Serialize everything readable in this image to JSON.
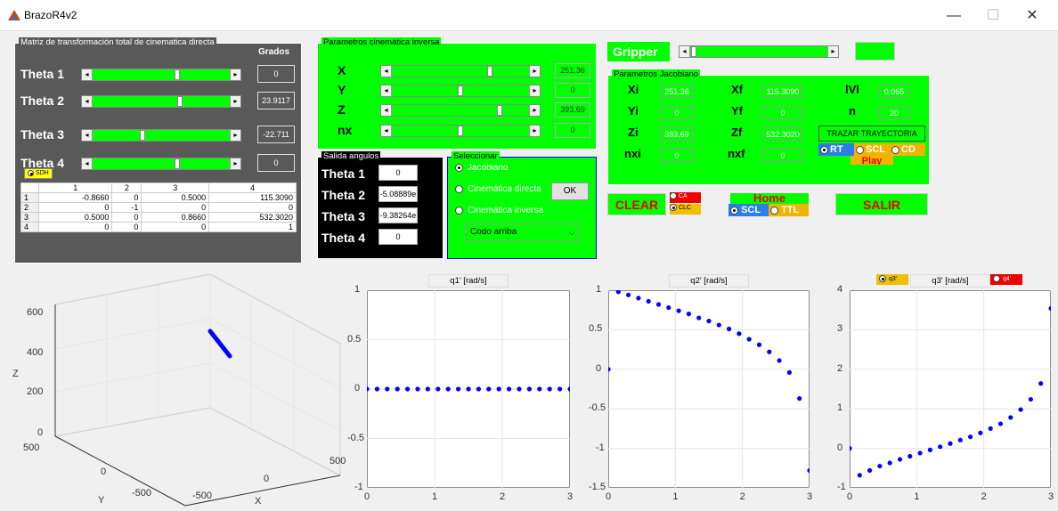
{
  "window": {
    "title": "BrazoR4v2",
    "min": "—",
    "max": "☐",
    "close": "✕",
    "app_icon": "matlab-icon"
  },
  "fk": {
    "title": "Matriz de transformación total de cinematica directa",
    "grados": "Grados",
    "rows": [
      {
        "label": "Theta 1",
        "value": "0",
        "pos": 0.62
      },
      {
        "label": "Theta 2",
        "value": "23.9117",
        "pos": 0.64
      },
      {
        "label": "Theta 3",
        "value": "-22.711",
        "pos": 0.36
      },
      {
        "label": "Theta 4",
        "value": "0",
        "pos": 0.62
      }
    ],
    "sdh": "SDH",
    "table": {
      "cols": [
        "1",
        "2",
        "3",
        "4"
      ],
      "rows": [
        [
          "1",
          "-0.8660",
          "0",
          "0.5000",
          "115.3090"
        ],
        [
          "2",
          "0",
          "-1",
          "0",
          "0"
        ],
        [
          "3",
          "0.5000",
          "0",
          "0.8660",
          "532.3020"
        ],
        [
          "4",
          "0",
          "0",
          "0",
          "1"
        ]
      ]
    }
  },
  "ik": {
    "title": "Parametros cinemática inversa",
    "rows": [
      {
        "label": "X",
        "value": "251.36",
        "pos": 0.72
      },
      {
        "label": "Y",
        "value": "0",
        "pos": 0.5
      },
      {
        "label": "Z",
        "value": "393.69",
        "pos": 0.8
      },
      {
        "label": "nx",
        "value": "0",
        "pos": 0.5
      }
    ]
  },
  "out": {
    "title": "Salida angulos",
    "rows": [
      {
        "label": "Theta 1",
        "value": "0"
      },
      {
        "label": "Theta 2",
        "value": "-5.08889e"
      },
      {
        "label": "Theta 3",
        "value": "-9.38264e"
      },
      {
        "label": "Theta 4",
        "value": "0"
      }
    ]
  },
  "sel": {
    "title": "Seleccionar",
    "options": [
      "Jacobiano",
      "Cinemática directa",
      "Cinemática inversa"
    ],
    "selected": 0,
    "ok": "OK",
    "dropdown": "Codo arriba"
  },
  "gripper": {
    "label": "Gripper",
    "pos": 0.0
  },
  "jac": {
    "title": "Parametros Jacobiano",
    "r1": {
      "xi": "Xi",
      "xiv": "251.36",
      "xf": "Xf",
      "xfv": "115.3090",
      "v": "lVl",
      "vv": "0.065"
    },
    "r2": {
      "yi": "Yi",
      "yiv": "0",
      "yf": "Yf",
      "yfv": "0",
      "n": "n",
      "nv": "20"
    },
    "r3": {
      "zi": "Zi",
      "ziv": "393.69",
      "zf": "Zf",
      "zfv": "532.3020",
      "trazar": "TRAZAR TRAYECTORIA"
    },
    "r4": {
      "nxi": "nxi",
      "nxiv": "0",
      "nxf": "nxf",
      "nxfv": "0",
      "rt": "RT",
      "scl": "SCL",
      "cd": "CD",
      "play": "Play"
    }
  },
  "btns": {
    "clear": "CLEAR",
    "ca": "CA",
    "clc": "CLC",
    "home": "Home",
    "scl": "SCL",
    "ttl": "TTL",
    "salir": "SALIR"
  },
  "plot3d": {
    "zlabel": "Z",
    "xlabel": "X",
    "ylabel": "Y",
    "zticks": [
      "600",
      "400",
      "200",
      "0"
    ],
    "yticks": [
      "500",
      "0",
      "-500"
    ],
    "xticks": [
      "-500",
      "0",
      "500"
    ]
  },
  "plots": [
    {
      "title": "q1'  [rad/s]",
      "yticks": [
        "1",
        "0.5",
        "0",
        "-0.5",
        "-1"
      ],
      "xticks": [
        "0",
        "1",
        "2",
        "3"
      ]
    },
    {
      "title": "q2'  [rad/s]",
      "yticks": [
        "1",
        "0.5",
        "0",
        "-0.5",
        "-1",
        "-1.5"
      ],
      "xticks": [
        "0",
        "1",
        "2",
        "3"
      ]
    },
    {
      "title": "q3'  [rad/s]",
      "yticks": [
        "4",
        "3",
        "2",
        "1",
        "0",
        "-1"
      ],
      "xticks": [
        "0",
        "1",
        "2",
        "3"
      ],
      "r1": "q3'",
      "r2": "q4'"
    }
  ],
  "chart_data": [
    {
      "type": "scatter",
      "title": "q1'  [rad/s]",
      "ylim": [
        -1,
        1
      ],
      "xlim": [
        0,
        3
      ],
      "x": [
        0,
        0.15,
        0.3,
        0.45,
        0.6,
        0.75,
        0.9,
        1.05,
        1.2,
        1.35,
        1.5,
        1.65,
        1.8,
        1.95,
        2.1,
        2.25,
        2.4,
        2.55,
        2.7,
        2.85,
        3
      ],
      "y": [
        0,
        0,
        0,
        0,
        0,
        0,
        0,
        0,
        0,
        0,
        0,
        0,
        0,
        0,
        0,
        0,
        0,
        0,
        0,
        0,
        0
      ]
    },
    {
      "type": "scatter",
      "title": "q2'  [rad/s]",
      "ylim": [
        -1.5,
        1
      ],
      "xlim": [
        0,
        3
      ],
      "x": [
        0,
        0.15,
        0.3,
        0.45,
        0.6,
        0.75,
        0.9,
        1.05,
        1.2,
        1.35,
        1.5,
        1.65,
        1.8,
        1.95,
        2.1,
        2.25,
        2.4,
        2.55,
        2.7,
        2.85,
        3
      ],
      "y": [
        0,
        0.98,
        0.94,
        0.9,
        0.86,
        0.82,
        0.78,
        0.74,
        0.7,
        0.65,
        0.61,
        0.56,
        0.51,
        0.45,
        0.38,
        0.31,
        0.22,
        0.11,
        -0.04,
        -0.37,
        -1.28
      ]
    },
    {
      "type": "scatter",
      "title": "q3'  [rad/s]",
      "ylim": [
        -1,
        4
      ],
      "xlim": [
        0,
        3
      ],
      "x": [
        0,
        0.15,
        0.3,
        0.45,
        0.6,
        0.75,
        0.9,
        1.05,
        1.2,
        1.35,
        1.5,
        1.65,
        1.8,
        1.95,
        2.1,
        2.25,
        2.4,
        2.55,
        2.7,
        2.85,
        3
      ],
      "y": [
        0,
        -0.68,
        -0.56,
        -0.45,
        -0.37,
        -0.28,
        -0.2,
        -0.12,
        -0.04,
        0.04,
        0.12,
        0.21,
        0.29,
        0.39,
        0.5,
        0.62,
        0.78,
        0.98,
        1.24,
        1.64,
        3.54
      ]
    }
  ]
}
